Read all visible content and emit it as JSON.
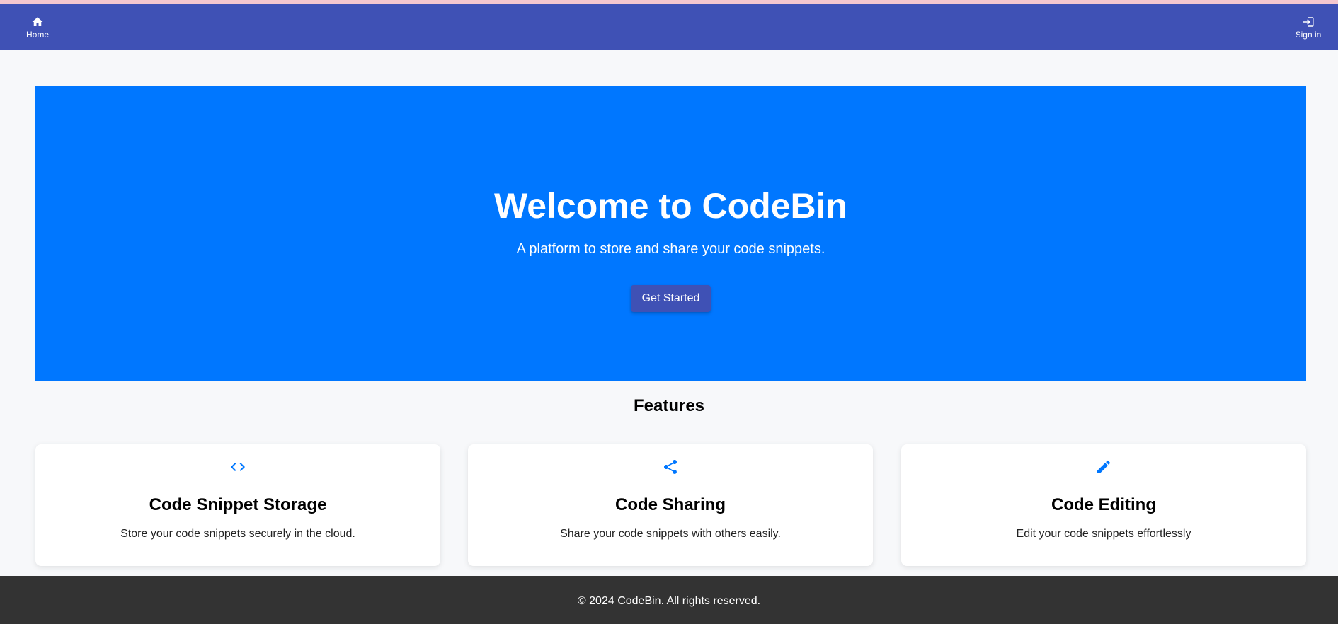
{
  "navbar": {
    "home": {
      "label": "Home",
      "icon": "home-icon"
    },
    "signin": {
      "label": "Sign in",
      "icon": "login-icon"
    },
    "color": "#3f51b5"
  },
  "hero": {
    "title": "Welcome to CodeBin",
    "subtitle": "A platform to store and share your code snippets.",
    "cta_label": "Get Started",
    "background": "#0077ff"
  },
  "features": {
    "title": "Features",
    "items": [
      {
        "icon": "code-icon",
        "title": "Code Snippet Storage",
        "description": "Store your code snippets securely in the cloud."
      },
      {
        "icon": "share-icon",
        "title": "Code Sharing",
        "description": "Share your code snippets with others easily."
      },
      {
        "icon": "pencil-icon",
        "title": "Code Editing",
        "description": "Edit your code snippets effortlessly"
      }
    ]
  },
  "footer": {
    "text": "© 2024 CodeBin. All rights reserved.",
    "background": "#333333"
  }
}
